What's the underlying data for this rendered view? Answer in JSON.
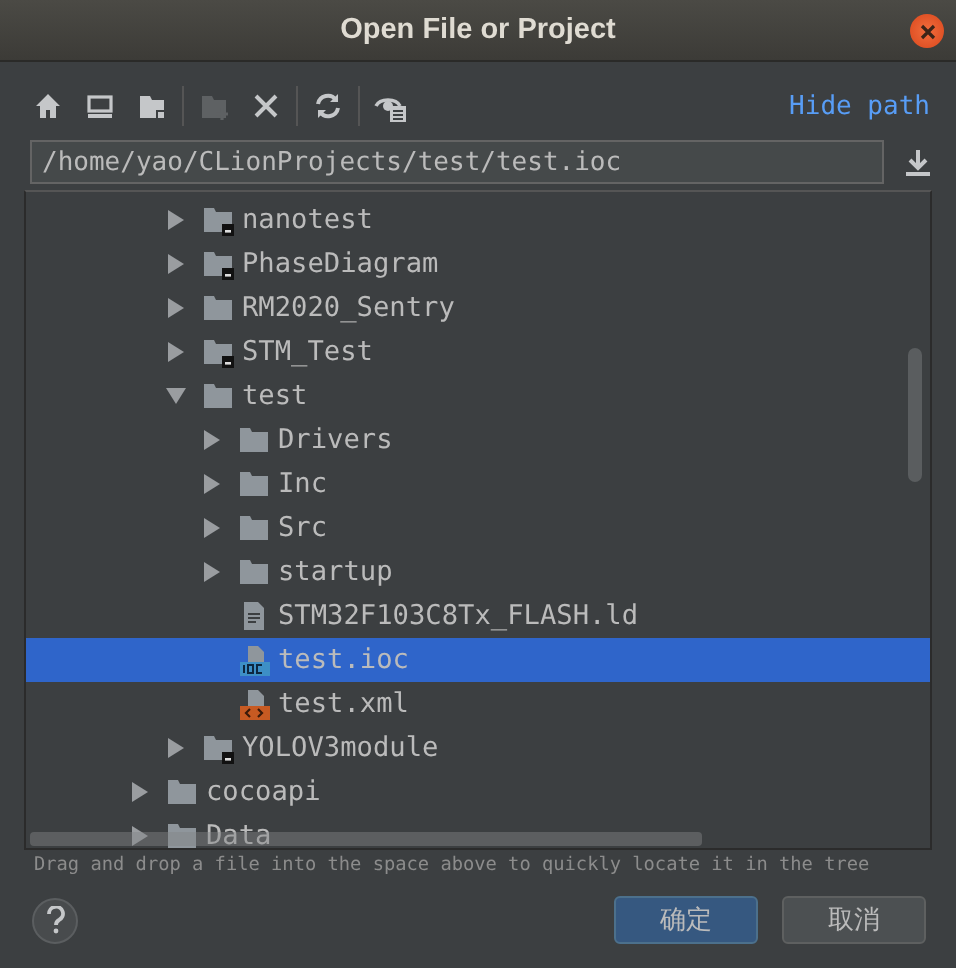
{
  "window": {
    "title": "Open File or Project"
  },
  "toolbar": {
    "groups": [
      {
        "buttons": [
          {
            "kind": "home",
            "disabled": false
          },
          {
            "kind": "desktop",
            "disabled": false
          },
          {
            "kind": "project",
            "disabled": false
          }
        ]
      },
      {
        "buttons": [
          {
            "kind": "new-folder",
            "disabled": true
          },
          {
            "kind": "delete",
            "disabled": false
          }
        ]
      },
      {
        "buttons": [
          {
            "kind": "refresh",
            "disabled": false
          }
        ]
      },
      {
        "buttons": [
          {
            "kind": "hidden-files",
            "disabled": false
          }
        ]
      }
    ],
    "link": "Hide path"
  },
  "path": {
    "value": "/home/yao/CLionProjects/test/test.ioc"
  },
  "tree": {
    "items": [
      {
        "children": [
          {
            "label": "nanotest",
            "kind": "module",
            "expanded": false,
            "selected": false
          },
          {
            "label": "PhaseDiagram",
            "kind": "module",
            "expanded": false,
            "selected": false
          },
          {
            "label": "RM2020_Sentry",
            "kind": "folder",
            "expanded": false,
            "selected": false
          },
          {
            "label": "STM_Test",
            "kind": "module",
            "expanded": false,
            "selected": false
          },
          {
            "label": "test",
            "kind": "folder",
            "expanded": true,
            "selected": false,
            "children": [
              {
                "label": "Drivers",
                "kind": "folder",
                "expanded": false,
                "selected": false
              },
              {
                "label": "Inc",
                "kind": "folder",
                "expanded": false,
                "selected": false
              },
              {
                "label": "Src",
                "kind": "folder",
                "expanded": false,
                "selected": false
              },
              {
                "label": "startup",
                "kind": "folder",
                "expanded": false,
                "selected": false
              },
              {
                "label": "STM32F103C8Tx_FLASH.ld",
                "kind": "text",
                "selected": false
              },
              {
                "label": "test.ioc",
                "kind": "ioc",
                "selected": true
              },
              {
                "label": "test.xml",
                "kind": "xml",
                "selected": false
              }
            ]
          },
          {
            "label": "YOLOV3module",
            "kind": "module",
            "expanded": false,
            "selected": false
          }
        ]
      },
      {
        "label": "cocoapi",
        "kind": "folder",
        "expanded": false,
        "selected": false
      },
      {
        "label": "Data",
        "kind": "folder",
        "expanded": false,
        "selected": false
      }
    ]
  },
  "hint": "Drag and drop a file into the space above to quickly locate it in the tree",
  "buttons": [
    {
      "label": "确定",
      "kind": "primary"
    },
    {
      "label": "取消",
      "kind": "secondary"
    }
  ]
}
